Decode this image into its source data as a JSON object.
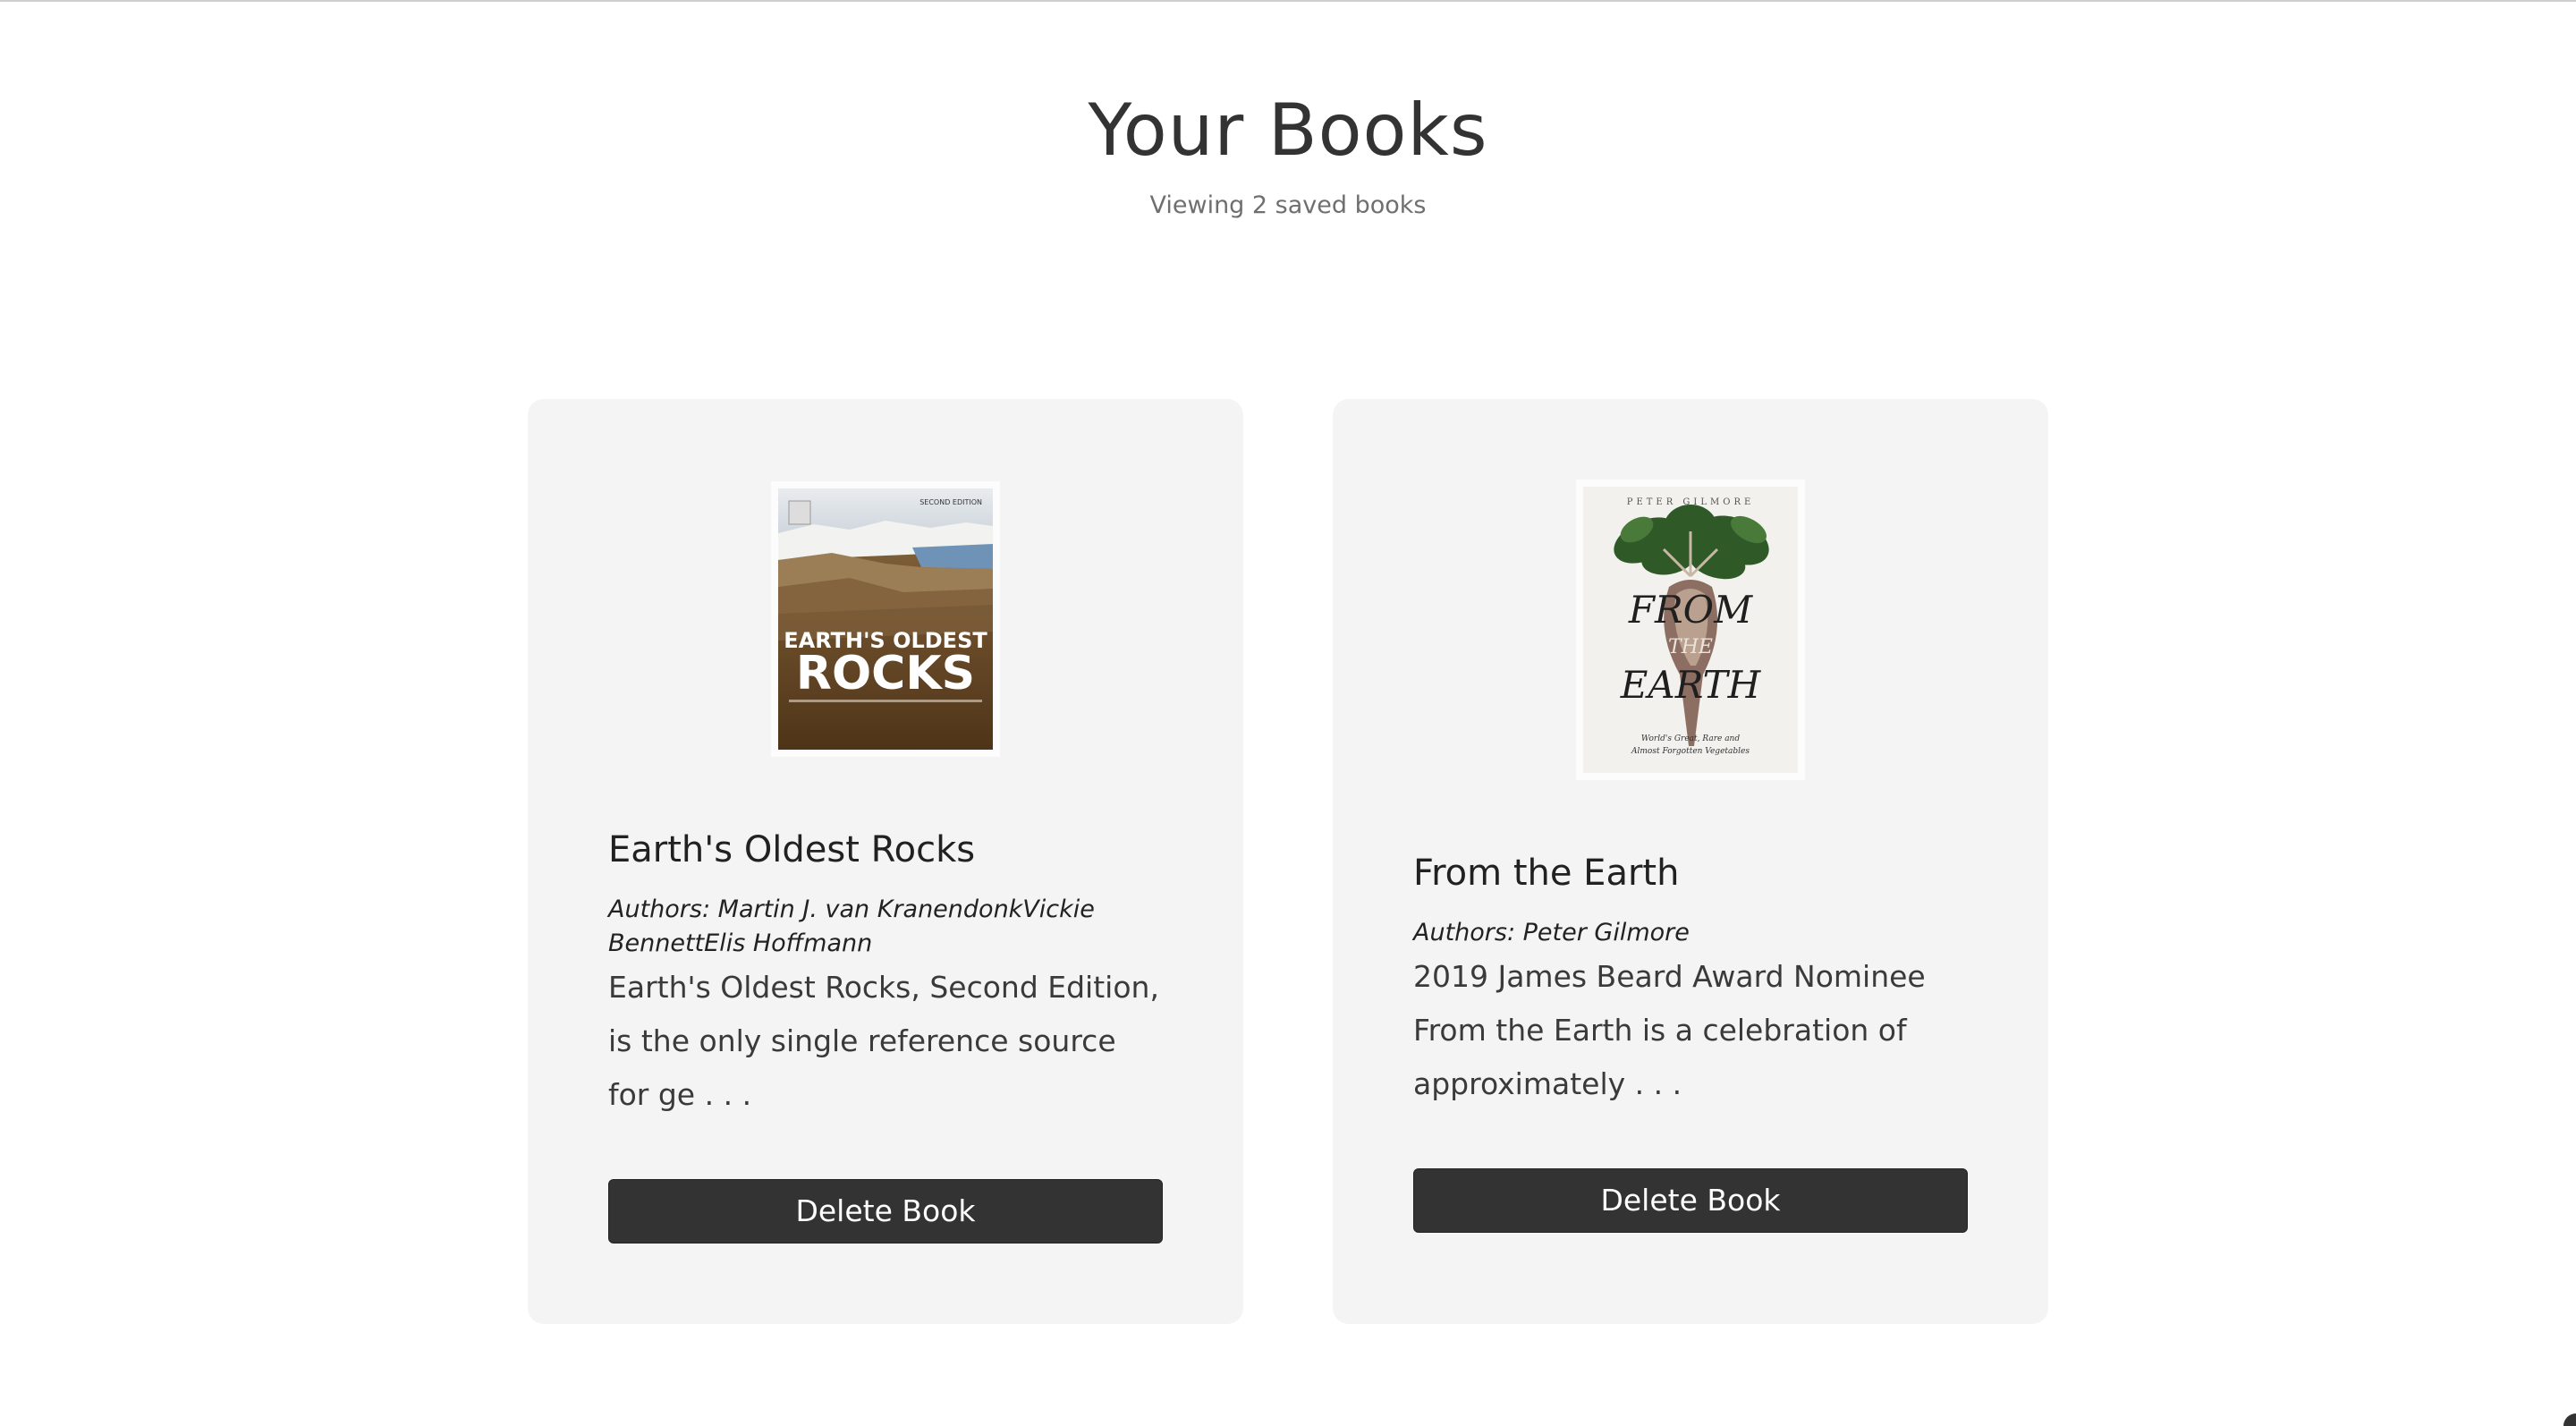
{
  "header": {
    "title": "Your Books",
    "subtitle": "Viewing 2 saved books"
  },
  "books": [
    {
      "title": "Earth's Oldest Rocks",
      "authors": "Authors: Martin J. van KranendonkVickie BennettElis Hoffmann",
      "description": "Earth's Oldest Rocks, Second Edition, is the only single reference source for ge . . .",
      "delete_label": "Delete Book",
      "cover": {
        "edition_text": "SECOND EDITION",
        "title_line1": "EARTH'S OLDEST",
        "title_line2": "ROCKS"
      }
    },
    {
      "title": "From the Earth",
      "authors": "Authors: Peter Gilmore",
      "description": "2019 James Beard Award Nominee From the Earth is a celebration of approximately . . .",
      "delete_label": "Delete Book",
      "cover": {
        "author_text": "PETER GILMORE",
        "title_line1": "FROM",
        "title_line2": "THE",
        "title_line3": "EARTH",
        "tagline1": "World's Great, Rare and",
        "tagline2": "Almost Forgotten Vegetables"
      }
    }
  ],
  "colors": {
    "card_bg": "#f4f4f4",
    "button_bg": "#333333",
    "button_text": "#ffffff",
    "title_text": "#333333",
    "subtitle_text": "#6f6f6f"
  }
}
